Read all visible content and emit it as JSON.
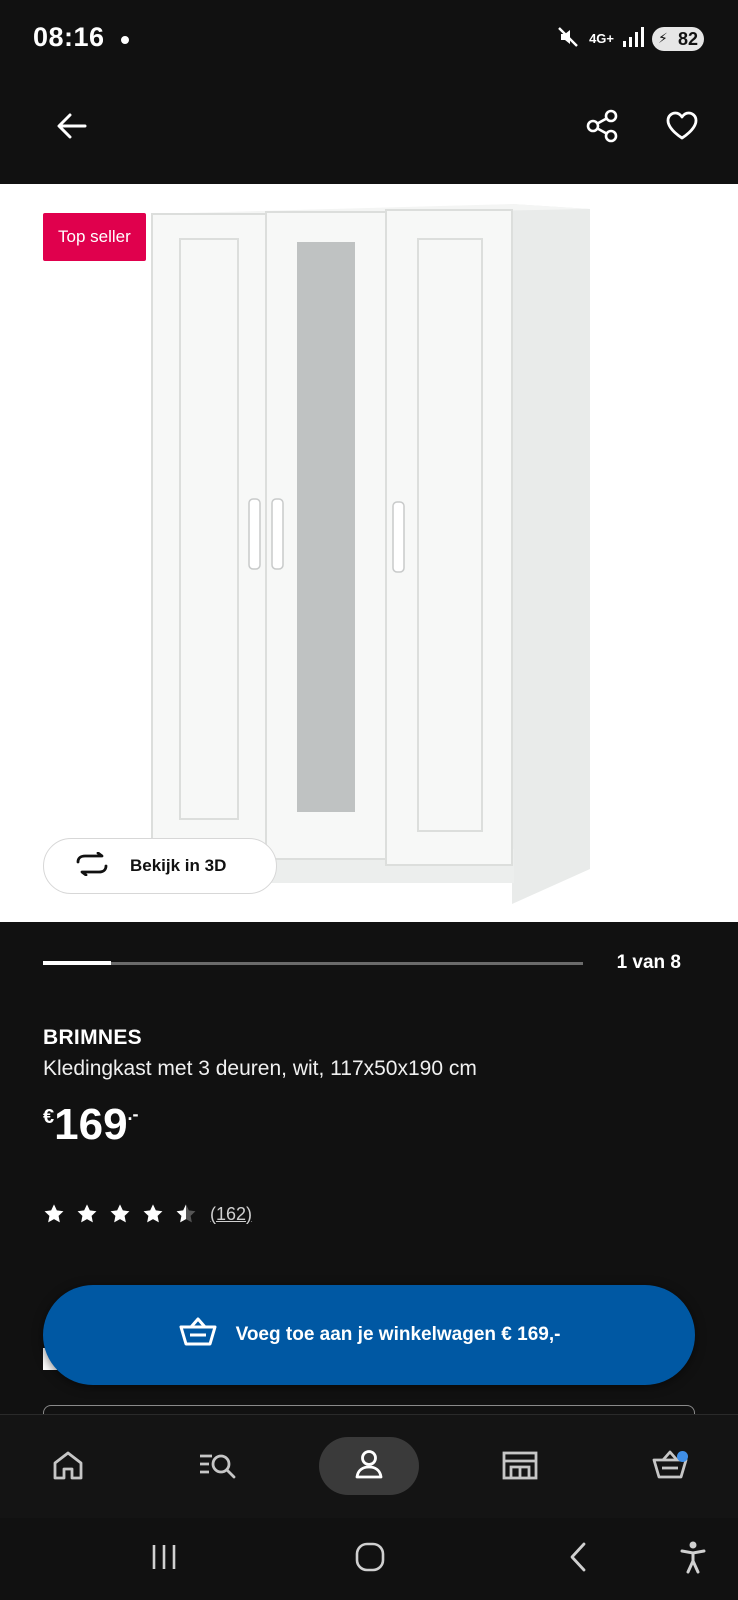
{
  "status_bar": {
    "time": "08:16",
    "network": "4G+",
    "battery": "82"
  },
  "app_bar": {
    "back_icon": "arrow-left-icon",
    "share_icon": "share-icon",
    "favorite_icon": "heart-icon"
  },
  "hero": {
    "badge": "Top seller",
    "view_3d_label": "Bekijk in 3D",
    "badge_color": "#e0004d"
  },
  "pager": {
    "text": "1 van 8",
    "current": 1,
    "total": 8
  },
  "product": {
    "name": "BRIMNES",
    "description": "Kledingkast met 3 deuren, wit, 117x50x190 cm",
    "price_currency": "€",
    "price_integer": "169",
    "price_decimal": ".-"
  },
  "rating": {
    "stars": 4.5,
    "count": "(162)"
  },
  "cart_button": {
    "label": "Voeg toe aan je winkelwagen € 169,-",
    "color": "#0058a3"
  },
  "bottom_nav": {
    "items": [
      {
        "icon": "home-icon"
      },
      {
        "icon": "search-list-icon"
      },
      {
        "icon": "profile-icon",
        "active": true
      },
      {
        "icon": "store-icon"
      },
      {
        "icon": "cart-icon",
        "badge": true
      }
    ]
  },
  "system_nav": {
    "items": [
      "recent-apps-icon",
      "home-circle-icon",
      "back-chevron-icon",
      "accessibility-icon"
    ]
  }
}
